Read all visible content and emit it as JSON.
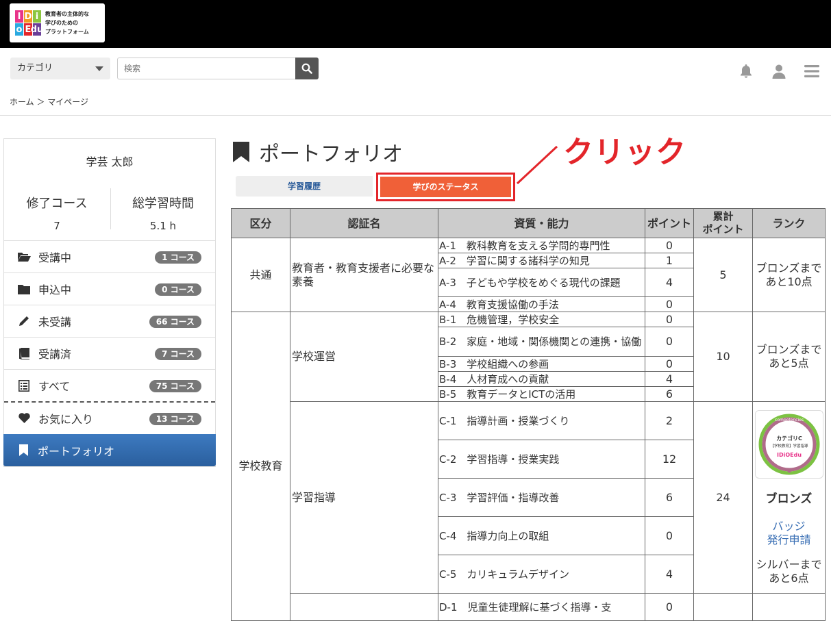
{
  "header": {
    "logo_text_lines": [
      "教育者の主体的な",
      "学びのための",
      "プラットフォーム"
    ],
    "logo_letters": [
      "I",
      "D",
      "i",
      "o",
      "E",
      "du"
    ],
    "category_label": "カテゴリ",
    "search_placeholder": "検索"
  },
  "breadcrumb": "ホーム ＞ マイページ",
  "sidebar": {
    "user_name": "学芸 太郎",
    "completed_label": "修了コース",
    "completed_value": "7",
    "hours_label": "総学習時間",
    "hours_value": "5.1 h",
    "items": [
      {
        "label": "受講中",
        "badge": "1 コース",
        "icon": "folder-open-icon"
      },
      {
        "label": "申込中",
        "badge": "0 コース",
        "icon": "folder-icon"
      },
      {
        "label": "未受講",
        "badge": "66 コース",
        "icon": "pencil-icon"
      },
      {
        "label": "受講済",
        "badge": "7 コース",
        "icon": "book-icon"
      },
      {
        "label": "すべて",
        "badge": "75 コース",
        "icon": "list-icon"
      },
      {
        "label": "お気に入り",
        "badge": "13 コース",
        "icon": "heart-icon"
      },
      {
        "label": "ポートフォリオ",
        "icon": "bookmark-icon"
      }
    ]
  },
  "main": {
    "title": "ポートフォリオ",
    "tabs": [
      "学習履歴",
      "学びのステータス"
    ],
    "annotation": "クリック",
    "table": {
      "headers": [
        "区分",
        "認証名",
        "資質・能力",
        "ポイント",
        "累計\nポイント",
        "ランク"
      ],
      "groups": {
        "common": "共通",
        "school": "学校教育"
      },
      "certs": {
        "a": "教育者・教育支援者に必要な素養",
        "b": "学校運営",
        "c": "学習指導"
      },
      "rows": [
        {
          "ability": "A-1　教科教育を支える学問的専門性",
          "point": "0"
        },
        {
          "ability": "A-2　学習に関する諸科学の知見",
          "point": "1"
        },
        {
          "ability": "A-3　子どもや学校をめぐる現代の課題",
          "point": "4"
        },
        {
          "ability": "A-4　教育支援協働の手法",
          "point": "0"
        },
        {
          "ability": "B-1　危機管理，学校安全",
          "point": "0"
        },
        {
          "ability": "B-2　家庭・地域・関係機関との連携・協働",
          "point": "0"
        },
        {
          "ability": "B-3　学校組織への参画",
          "point": "0"
        },
        {
          "ability": "B-4　人材育成への貢献",
          "point": "4"
        },
        {
          "ability": "B-5　教育データとICTの活用",
          "point": "6"
        },
        {
          "ability": "C-1　指導計画・授業づくり",
          "point": "2"
        },
        {
          "ability": "C-2　学習指導・授業実践",
          "point": "12"
        },
        {
          "ability": "C-3　学習評価・指導改善",
          "point": "6"
        },
        {
          "ability": "C-4　指導力向上の取組",
          "point": "0"
        },
        {
          "ability": "C-5　カリキュラムデザイン",
          "point": "4"
        },
        {
          "ability": "D-1　児童生徒理解に基づく指導・支",
          "point": "0"
        }
      ],
      "totals": {
        "a": "5",
        "b": "10",
        "c": "24"
      },
      "ranks": {
        "a": "ブロンズまで\nあと10点",
        "b": "ブロンズまで\nあと5点",
        "c_rank": "ブロンズ",
        "c_badge_link": "バッジ\n発行申請",
        "c_remaining": "シルバーまで\nあと6点"
      },
      "medal": {
        "top": "competencies",
        "line1": "カテゴリC",
        "line2": "【学校教育】学習指導",
        "brand": "IDiOEdu"
      }
    }
  },
  "colors": {
    "accent": "#f06038",
    "annotation": "#e3252a",
    "active_menu": "#2a5f9e",
    "link": "#3a6fb4"
  }
}
